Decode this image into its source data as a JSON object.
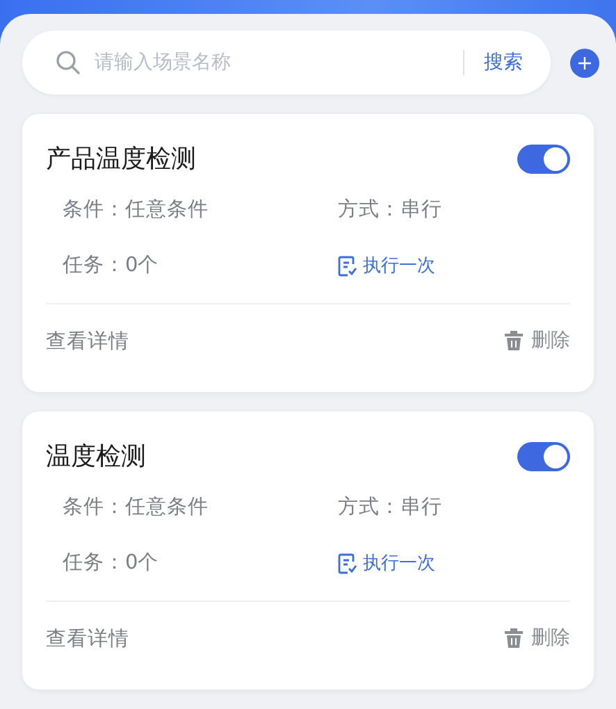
{
  "search": {
    "placeholder": "请输入场景名称",
    "button": "搜索"
  },
  "scenes": [
    {
      "title": "产品温度检测",
      "on": true,
      "condition": "条件：任意条件",
      "mode": "方式：串行",
      "tasks": "任务：0个",
      "run_once": "执行一次",
      "details": "查看详情",
      "delete": "删除"
    },
    {
      "title": "温度检测",
      "on": true,
      "condition": "条件：任意条件",
      "mode": "方式：串行",
      "tasks": "任务：0个",
      "run_once": "执行一次",
      "details": "查看详情",
      "delete": "删除"
    }
  ]
}
